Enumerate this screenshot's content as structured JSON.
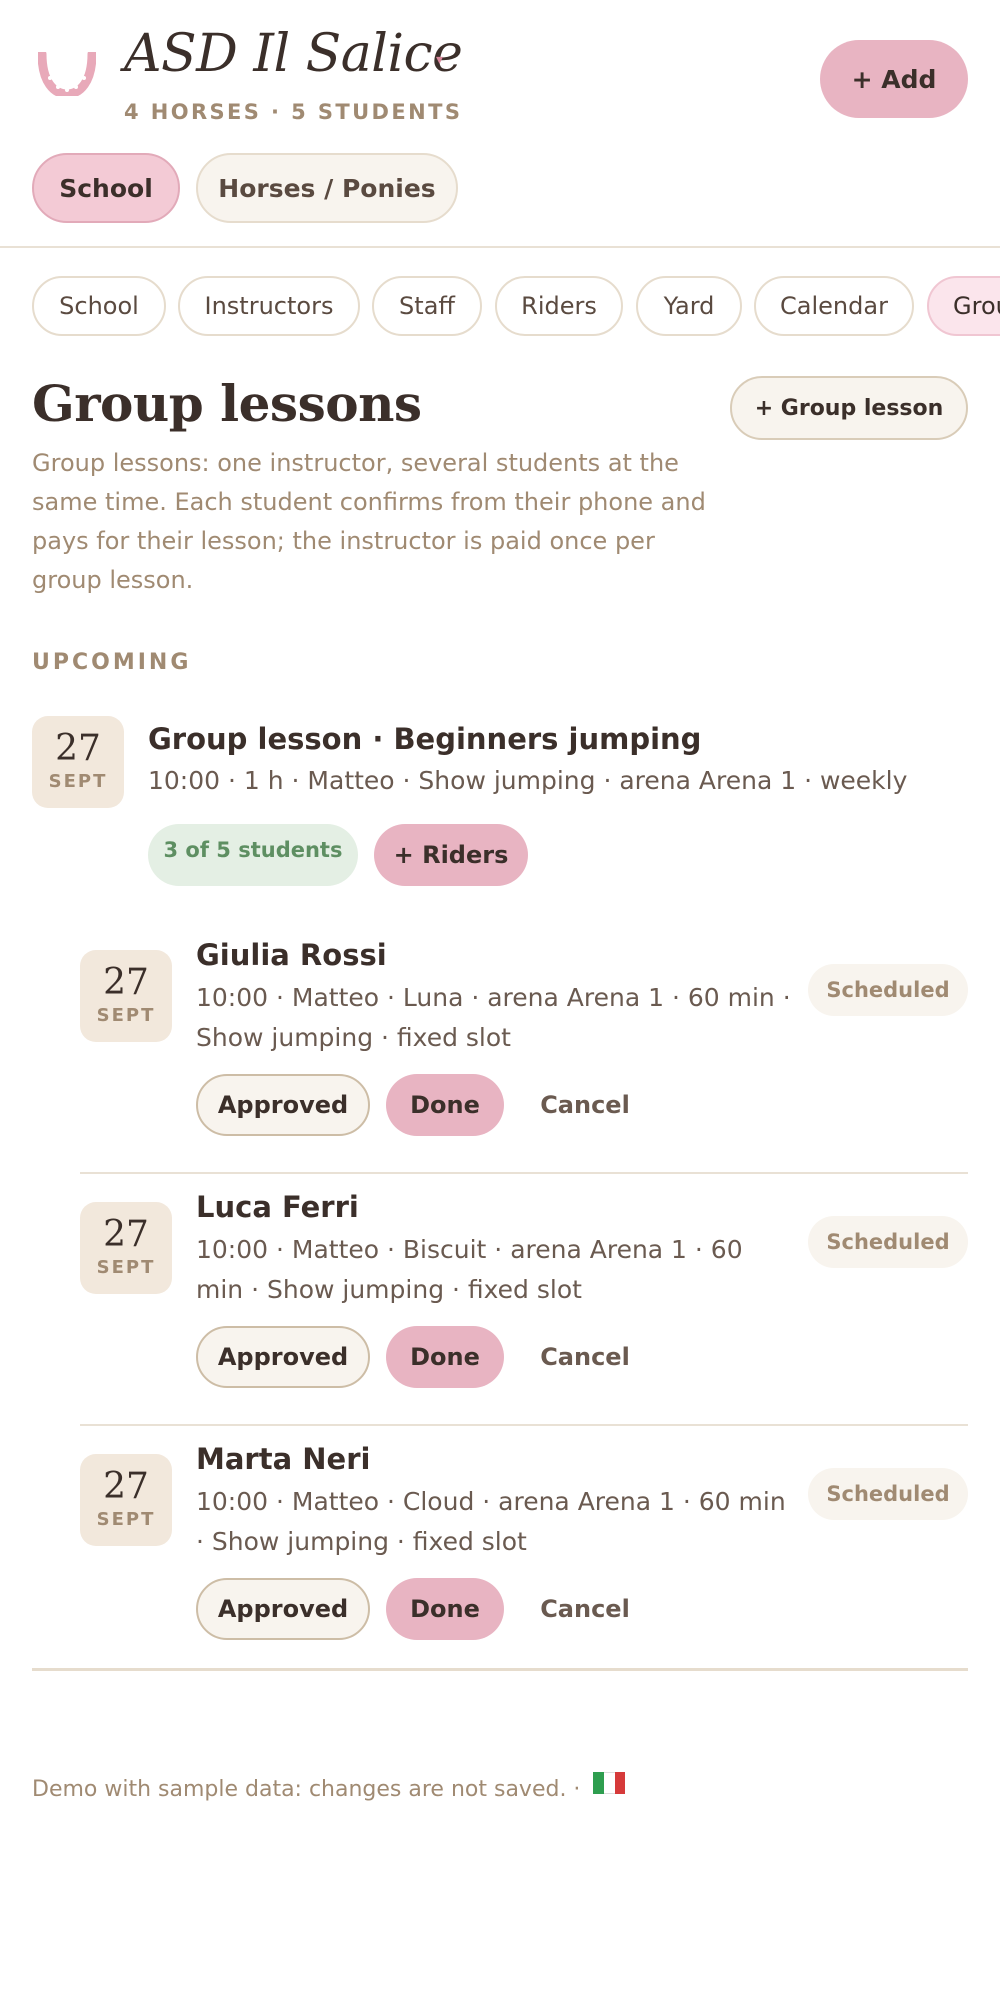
{
  "header": {
    "club_name": "ASD Il Salice",
    "club_caret": "▾",
    "subtitle": "4 HORSES · 5 STUDENTS",
    "add_label": "+ Add",
    "segments": [
      "School",
      "Horses / Ponies"
    ],
    "accent_color": "#e8b4c2"
  },
  "nav": {
    "chips": [
      "School",
      "Instructors",
      "Staff",
      "Riders",
      "Yard",
      "Calendar",
      "Group lessons"
    ],
    "active": "Group lessons"
  },
  "section": {
    "title": "Group lessons",
    "add_group_label": "+ Group lesson",
    "description": "Group lessons: one instructor, several students at the same time. Each student confirms from their phone and pays for their lesson; the instructor is paid once per group lesson.",
    "upcoming_label": "UPCOMING"
  },
  "group_lesson": {
    "date_day": "27",
    "date_month": "SEPT",
    "title": "Group lesson · Beginners jumping",
    "meta": "10:00 · 1 h · Matteo · Show jumping · arena Arena 1 · weekly",
    "students_badge": "3 of 5 students",
    "riders_label": "+ Riders",
    "students": [
      {
        "date_day": "27",
        "date_month": "SEPT",
        "name": "Giulia Rossi",
        "meta": "10:00 · Matteo · Luna · arena Arena 1 · 60 min · Show jumping · fixed slot",
        "status": "Scheduled",
        "approved_label": "Approved",
        "done_label": "Done",
        "cancel_label": "Cancel"
      },
      {
        "date_day": "27",
        "date_month": "SEPT",
        "name": "Luca Ferri",
        "meta": "10:00 · Matteo · Biscuit · arena Arena 1 · 60 min · Show jumping · fixed slot",
        "status": "Scheduled",
        "approved_label": "Approved",
        "done_label": "Done",
        "cancel_label": "Cancel"
      },
      {
        "date_day": "27",
        "date_month": "SEPT",
        "name": "Marta Neri",
        "meta": "10:00 · Matteo · Cloud · arena Arena 1 · 60 min · Show jumping · fixed slot",
        "status": "Scheduled",
        "approved_label": "Approved",
        "done_label": "Done",
        "cancel_label": "Cancel"
      }
    ]
  },
  "footer": {
    "text": "Demo with sample data: changes are not saved. ·",
    "flag_icon": "italian-flag-icon"
  }
}
